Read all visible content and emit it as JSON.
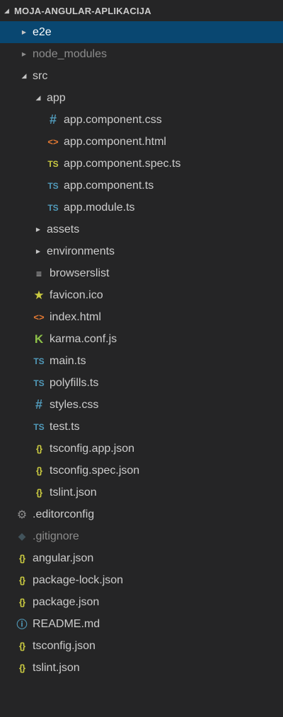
{
  "explorer": {
    "section_title": "MOJA-ANGULAR-APLIKACIJA",
    "items": [
      {
        "label": "e2e",
        "kind": "folder",
        "depth": 1,
        "expanded": false,
        "selected": true
      },
      {
        "label": "node_modules",
        "kind": "folder",
        "depth": 1,
        "expanded": false,
        "dimmed": true
      },
      {
        "label": "src",
        "kind": "folder",
        "depth": 1,
        "expanded": true
      },
      {
        "label": "app",
        "kind": "folder",
        "depth": 2,
        "expanded": true
      },
      {
        "label": "app.component.css",
        "kind": "file",
        "icon": "css-icon",
        "depth": 3
      },
      {
        "label": "app.component.html",
        "kind": "file",
        "icon": "html-icon",
        "depth": 3
      },
      {
        "label": "app.component.spec.ts",
        "kind": "file",
        "icon": "ts-spec-icon",
        "depth": 3
      },
      {
        "label": "app.component.ts",
        "kind": "file",
        "icon": "ts-icon",
        "depth": 3
      },
      {
        "label": "app.module.ts",
        "kind": "file",
        "icon": "ts-icon",
        "depth": 3
      },
      {
        "label": "assets",
        "kind": "folder",
        "depth": 2,
        "expanded": false
      },
      {
        "label": "environments",
        "kind": "folder",
        "depth": 2,
        "expanded": false
      },
      {
        "label": "browserslist",
        "kind": "file",
        "icon": "list-icon",
        "depth": 2
      },
      {
        "label": "favicon.ico",
        "kind": "file",
        "icon": "star-icon",
        "depth": 2
      },
      {
        "label": "index.html",
        "kind": "file",
        "icon": "html-icon",
        "depth": 2
      },
      {
        "label": "karma.conf.js",
        "kind": "file",
        "icon": "karma-icon",
        "depth": 2
      },
      {
        "label": "main.ts",
        "kind": "file",
        "icon": "ts-icon",
        "depth": 2
      },
      {
        "label": "polyfills.ts",
        "kind": "file",
        "icon": "ts-icon",
        "depth": 2
      },
      {
        "label": "styles.css",
        "kind": "file",
        "icon": "css-icon",
        "depth": 2
      },
      {
        "label": "test.ts",
        "kind": "file",
        "icon": "ts-icon",
        "depth": 2
      },
      {
        "label": "tsconfig.app.json",
        "kind": "file",
        "icon": "json-icon",
        "depth": 2
      },
      {
        "label": "tsconfig.spec.json",
        "kind": "file",
        "icon": "json-icon",
        "depth": 2
      },
      {
        "label": "tslint.json",
        "kind": "file",
        "icon": "json-icon",
        "depth": 2
      },
      {
        "label": ".editorconfig",
        "kind": "file",
        "icon": "gear-icon",
        "depth": 1
      },
      {
        "label": ".gitignore",
        "kind": "file",
        "icon": "git-icon",
        "depth": 1,
        "dimmed": true
      },
      {
        "label": "angular.json",
        "kind": "file",
        "icon": "json-icon",
        "depth": 1
      },
      {
        "label": "package-lock.json",
        "kind": "file",
        "icon": "json-icon",
        "depth": 1
      },
      {
        "label": "package.json",
        "kind": "file",
        "icon": "json-icon",
        "depth": 1
      },
      {
        "label": "README.md",
        "kind": "file",
        "icon": "info-icon",
        "depth": 1
      },
      {
        "label": "tsconfig.json",
        "kind": "file",
        "icon": "json-icon",
        "depth": 1
      },
      {
        "label": "tslint.json",
        "kind": "file",
        "icon": "json-icon",
        "depth": 1
      }
    ]
  },
  "icon_glyphs": {
    "css-icon": "#",
    "html-icon": "<>",
    "ts-icon": "TS",
    "ts-spec-icon": "TS",
    "json-icon": "{}",
    "star-icon": "★",
    "karma-icon": "K",
    "list-icon": "≡",
    "gear-icon": "⚙",
    "git-icon": "◆",
    "info-icon": "ⓘ"
  },
  "colors": {
    "background": "#252526",
    "selection": "#094771",
    "text": "#cccccc",
    "ts_blue": "#519aba",
    "json_yellow": "#cbcb41",
    "html_orange": "#e37933",
    "karma_green": "#8dc149"
  }
}
